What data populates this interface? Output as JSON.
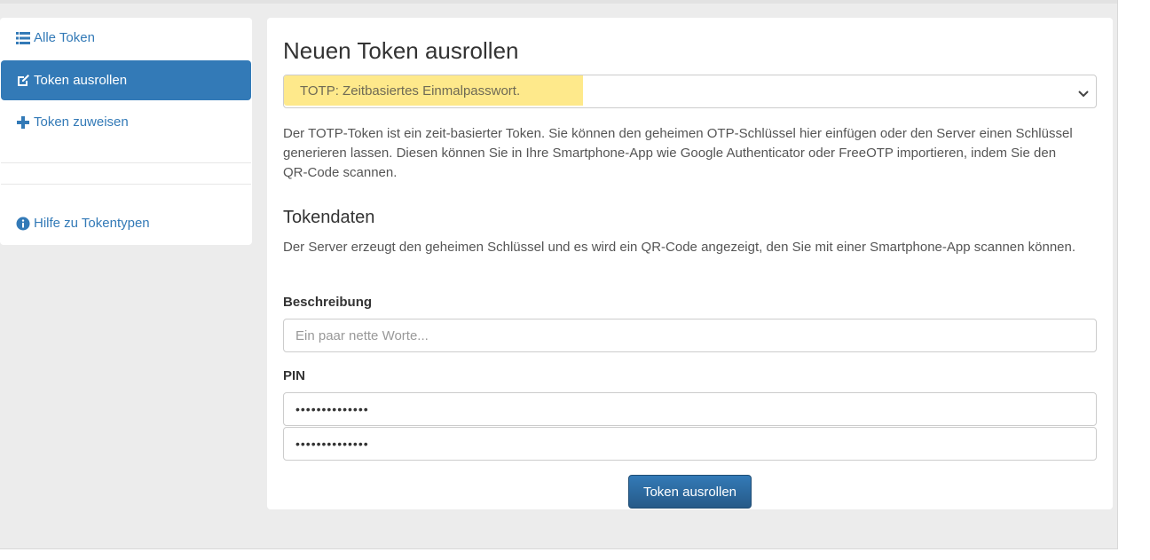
{
  "sidebar": {
    "items": [
      {
        "label": "Alle Token",
        "icon": "list-icon",
        "active": false
      },
      {
        "label": "Token ausrollen",
        "icon": "edit-icon",
        "active": true
      },
      {
        "label": "Token zuweisen",
        "icon": "plus-icon",
        "active": false
      },
      {
        "label": "Hilfe zu Tokentypen",
        "icon": "info-circle-icon",
        "active": false
      }
    ]
  },
  "main": {
    "title": "Neuen Token ausrollen",
    "token_type_select": {
      "selected": "TOTP: Zeitbasiertes Einmalpasswort."
    },
    "description": "Der TOTP-Token ist ein zeit-basierter Token. Sie können den geheimen OTP-Schlüssel hier einfügen oder den Server einen Schlüssel generieren lassen. Diesen können Sie in Ihre Smartphone-App wie Google Authenticator oder FreeOTP importieren, indem Sie den QR-Code scannen.",
    "tokendata": {
      "heading": "Tokendaten",
      "text": "Der Server erzeugt den geheimen Schlüssel und es wird ein QR-Code angezeigt, den Sie mit einer Smartphone-App scannen können."
    },
    "description_field": {
      "label": "Beschreibung",
      "placeholder": "Ein paar nette Worte..."
    },
    "pin": {
      "label": "PIN",
      "value": "••••••••••••••",
      "confirm_value": "••••••••••••••"
    },
    "submit_label": "Token ausrollen"
  },
  "colors": {
    "primary": "#337ab7",
    "highlight": "#fee98b",
    "background": "#ececec"
  }
}
